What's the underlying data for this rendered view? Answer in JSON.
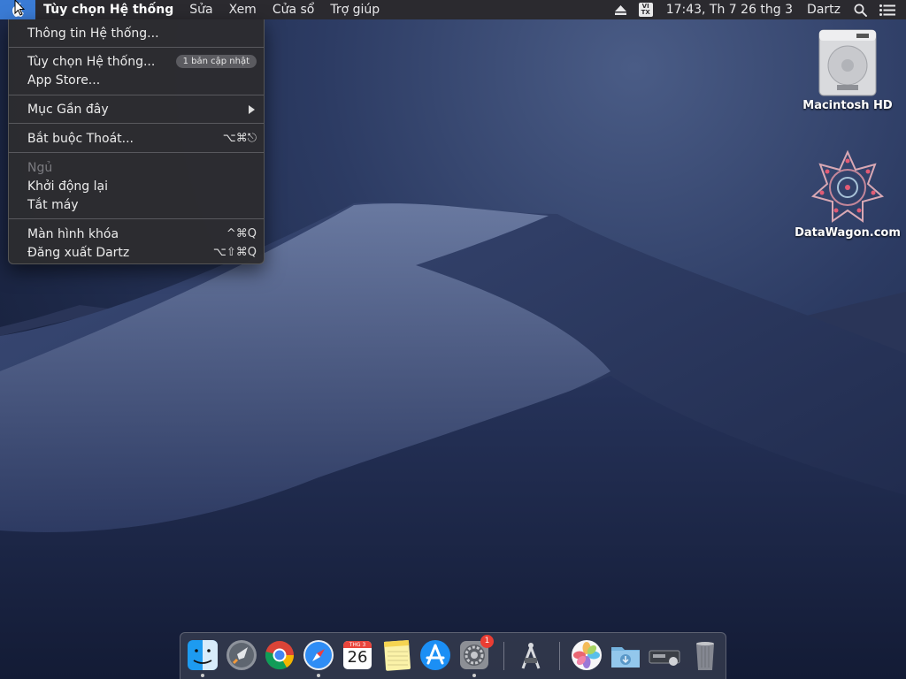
{
  "menubar": {
    "app_name": "Tùy chọn Hệ thống",
    "menus": [
      "Sửa",
      "Xem",
      "Cửa sổ",
      "Trợ giúp"
    ],
    "input_source_top": "VI",
    "input_source_bottom": "TX",
    "clock": "17:43, Th 7 26 thg 3",
    "user": "Dartz"
  },
  "apple_menu": {
    "about": "Thông tin Hệ thống...",
    "system_prefs": "Tùy chọn Hệ thống...",
    "update_badge": "1 bản cập nhật",
    "app_store": "App Store...",
    "recent_items": "Mục Gần đây",
    "force_quit": "Bắt buộc Thoát...",
    "force_quit_shortcut": "⌥⌘⎋",
    "sleep": "Ngủ",
    "restart": "Khởi động lại",
    "shutdown": "Tắt máy",
    "lock_screen": "Màn hình khóa",
    "lock_screen_shortcut": "^⌘Q",
    "logout": "Đăng xuất Dartz",
    "logout_shortcut": "⌥⇧⌘Q"
  },
  "desktop": {
    "hd_label": "Macintosh HD",
    "datawagon_label": "DataWagon.com"
  },
  "dock": {
    "calendar_month": "THG 3",
    "calendar_day": "26",
    "prefs_badge": "1",
    "items": [
      "finder-icon",
      "launchpad-icon",
      "chrome-icon",
      "safari-icon",
      "calendar-icon",
      "notes-icon",
      "app-store-icon",
      "system-preferences-icon",
      "screenshot-tool-icon",
      "photos-icon",
      "downloads-folder-icon",
      "disk-utility-icon",
      "trash-icon"
    ]
  }
}
